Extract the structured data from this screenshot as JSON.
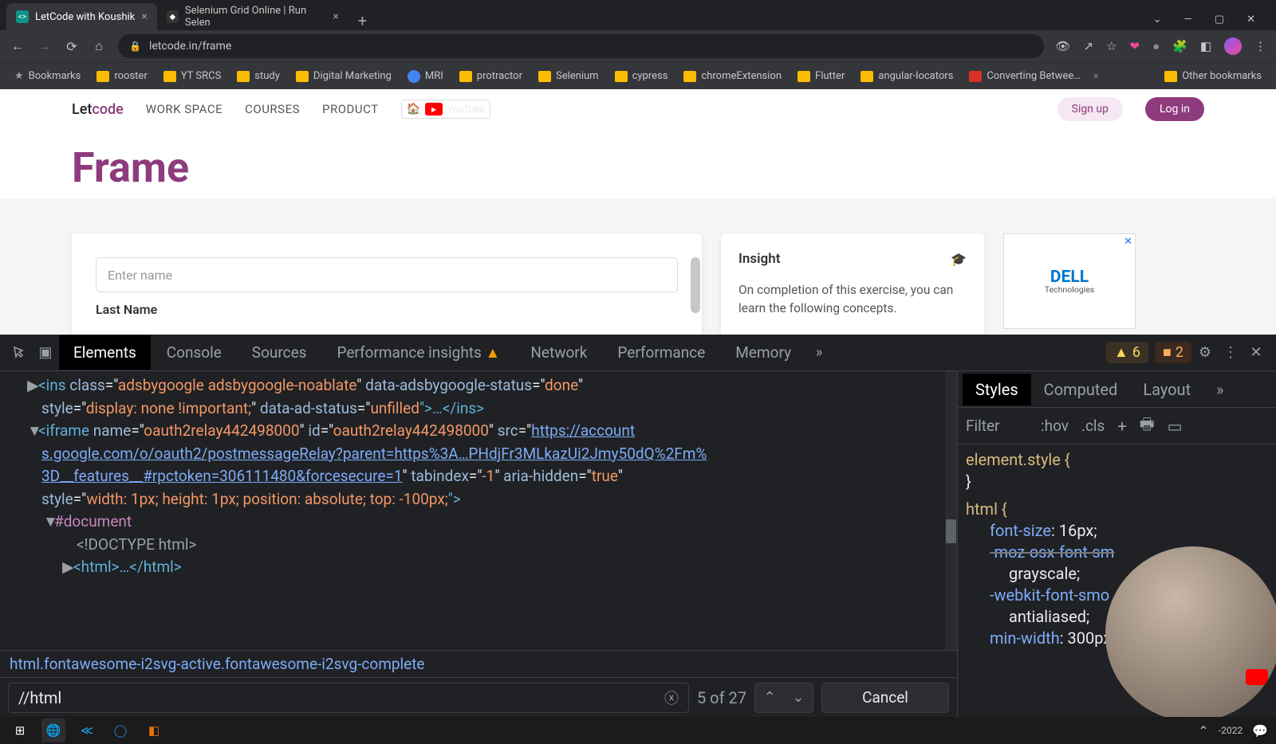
{
  "tabs": [
    {
      "title": "LetCode with Koushik",
      "active": true
    },
    {
      "title": "Selenium Grid Online | Run Selen",
      "active": false
    }
  ],
  "url": "letcode.in/frame",
  "bookmarks": {
    "star": "Bookmarks",
    "items": [
      "rooster",
      "YT SRCS",
      "study",
      "Digital Marketing",
      "MRI",
      "protractor",
      "Selenium",
      "cypress",
      "chromeExtension",
      "Flutter",
      "angular-locators"
    ],
    "converting": "Converting Betwee…",
    "other": "Other bookmarks"
  },
  "page": {
    "logo_let": "Let",
    "logo_code": "code",
    "nav": [
      "WORK SPACE",
      "COURSES",
      "PRODUCT"
    ],
    "youtube": "YouTube",
    "signup": "Sign up",
    "login": "Log in",
    "title": "Frame",
    "input_placeholder": "Enter name",
    "last_name": "Last Name",
    "insight_title": "Insight",
    "insight_text": "On completion of this exercise, you can learn the following concepts.",
    "ad_brand": "DELL",
    "ad_sub": "Technologies"
  },
  "devtools": {
    "tabs": [
      "Elements",
      "Console",
      "Sources",
      "Performance insights",
      "Network",
      "Performance",
      "Memory"
    ],
    "active_tab": "Elements",
    "warn_count": "6",
    "err_count": "2",
    "styles_tabs": [
      "Styles",
      "Computed",
      "Layout"
    ],
    "styles_active": "Styles",
    "filter": "Filter",
    "hov": ":hov",
    "cls": ".cls",
    "rule_el": "element.style {",
    "rule_el_close": "}",
    "rule_html": "html {",
    "p_fs": "font-size",
    "v_fs": "16px;",
    "p_moz": "-moz-osx-font-sm",
    "v_moz": "grayscale;",
    "p_wk": "-webkit-font-smo",
    "v_aa": "antialiased;",
    "p_mw": "min-width",
    "v_mw": "300px;",
    "crumb": "html.fontawesome-i2svg-active.fontawesome-i2svg-complete",
    "find_value": "//html",
    "find_count": "5 of 27",
    "cancel": "Cancel",
    "dom": {
      "l1a": "<ins ",
      "l1b": "class",
      "l1c": "=\"",
      "l1d": "adsbygoogle adsbygoogle-noablate",
      "l1e": "\" ",
      "l1f": "data-adsbygoogle-status",
      "l1g": "=\"",
      "l1h": "done",
      "l1i": "\"",
      "l2a": "style",
      "l2b": "=\"",
      "l2c": "display: none !important;",
      "l2d": "\" ",
      "l2e": "data-ad-status",
      "l2f": "=\"",
      "l2g": "unfilled",
      "l2h": "\">…</",
      "l2i": "ins",
      "l2j": ">",
      "l3a": "<iframe ",
      "l3b": "name",
      "l3c": "=\"",
      "l3d": "oauth2relay442498000",
      "l3e": "\" ",
      "l3f": "id",
      "l3g": "=\"",
      "l3h": "oauth2relay442498000",
      "l3i": "\" ",
      "l3j": "src",
      "l3k": "=\"",
      "l3l": "https://account",
      "l4": "s.google.com/o/oauth2/postmessageRelay?parent=https%3A…PHdjFr3MLkazUi2Jmy50dQ%2Fm%",
      "l5a": "3D__features__#rpctoken=306111480&forcesecure=1",
      "l5b": "\" ",
      "l5c": "tabindex",
      "l5d": "=\"",
      "l5e": "-1",
      "l5f": "\" ",
      "l5g": "aria-hidden",
      "l5h": "=\"",
      "l5i": "true",
      "l5j": "\"",
      "l6a": "style",
      "l6b": "=\"",
      "l6c": "width: 1px; height: 1px; position: absolute; top: -100px;",
      "l6d": "\">",
      "l7": "#document",
      "l8": "<!DOCTYPE html>",
      "l9a": "<",
      "l9b": "html",
      "l9c": ">…</",
      "l9d": "html",
      "l9e": ">"
    }
  },
  "taskbar": {
    "date": "-2022"
  }
}
